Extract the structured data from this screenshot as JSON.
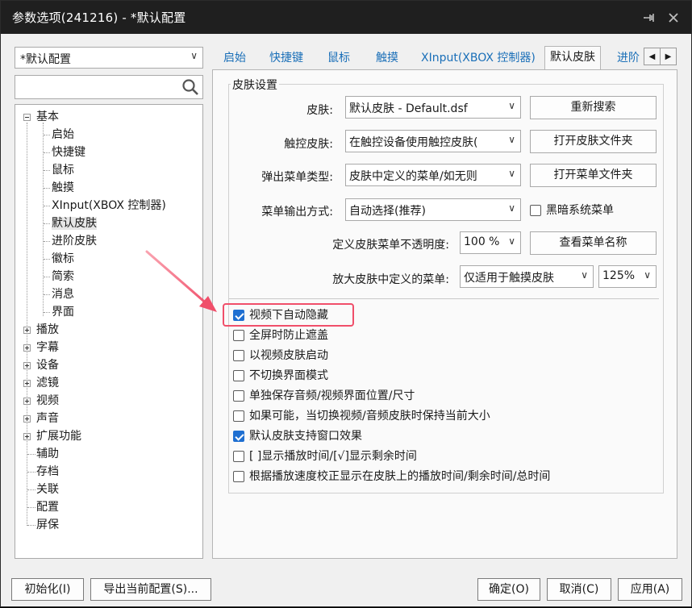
{
  "window": {
    "title": "参数选项(241216) - *默认配置"
  },
  "sidebar": {
    "profile_value": "*默认配置",
    "search_placeholder": "",
    "tree": {
      "basic": "基本",
      "basic_children": [
        "启始",
        "快捷键",
        "鼠标",
        "触摸",
        "XInput(XBOX 控制器)",
        "默认皮肤",
        "进阶皮肤",
        "徽标",
        "简索",
        "消息",
        "界面"
      ],
      "collapsed": [
        "播放",
        "字幕",
        "设备",
        "滤镜",
        "视频",
        "声音",
        "扩展功能"
      ],
      "leaves": [
        "辅助",
        "存档",
        "关联",
        "配置",
        "屏保"
      ]
    }
  },
  "tabs": [
    "启始",
    "快捷键",
    "鼠标",
    "触摸",
    "XInput(XBOX 控制器)",
    "默认皮肤",
    "进阶"
  ],
  "group": {
    "title": "皮肤设置",
    "skin_label": "皮肤:",
    "skin_value": "默认皮肤 - Default.dsf",
    "rescan_button": "重新搜索",
    "touch_skin_label": "触控皮肤:",
    "touch_skin_value": "在触控设备使用触控皮肤(",
    "open_skin_folder_button": "打开皮肤文件夹",
    "popup_menu_label": "弹出菜单类型:",
    "popup_menu_value": "皮肤中定义的菜单/如无则",
    "open_menu_folder_button": "打开菜单文件夹",
    "menu_output_label": "菜单输出方式:",
    "menu_output_value": "自动选择(推荐)",
    "dark_menu_label": "黑暗系统菜单",
    "opacity_label": "定义皮肤菜单不透明度:",
    "opacity_value": "100 %",
    "view_menu_names_button": "查看菜单名称",
    "enlarge_label": "放大皮肤中定义的菜单:",
    "enlarge_value": "仅适用于触摸皮肤",
    "enlarge_percent": "125%"
  },
  "options": [
    {
      "label": "视频下自动隐藏",
      "checked": true
    },
    {
      "label": "全屏时防止遮盖",
      "checked": false
    },
    {
      "label": "以视频皮肤启动",
      "checked": false
    },
    {
      "label": "不切换界面模式",
      "checked": false
    },
    {
      "label": "单独保存音频/视频界面位置/尺寸",
      "checked": false
    },
    {
      "label": "如果可能，当切换视频/音频皮肤时保持当前大小",
      "checked": false
    },
    {
      "label": "默认皮肤支持窗口效果",
      "checked": true
    },
    {
      "label": "[ ]显示播放时间/[√]显示剩余时间",
      "checked": false
    },
    {
      "label": "根据播放速度校正显示在皮肤上的播放时间/剩余时间/总时间",
      "checked": false
    }
  ],
  "footer": {
    "init_button": "初始化(I)",
    "export_button": "导出当前配置(S)...",
    "ok_button": "确定(O)",
    "cancel_button": "取消(C)",
    "apply_button": "应用(A)"
  },
  "colors": {
    "accent": "#1f6fd1",
    "annotation": "#f04f6a",
    "tab_link": "#1a6fb8"
  }
}
